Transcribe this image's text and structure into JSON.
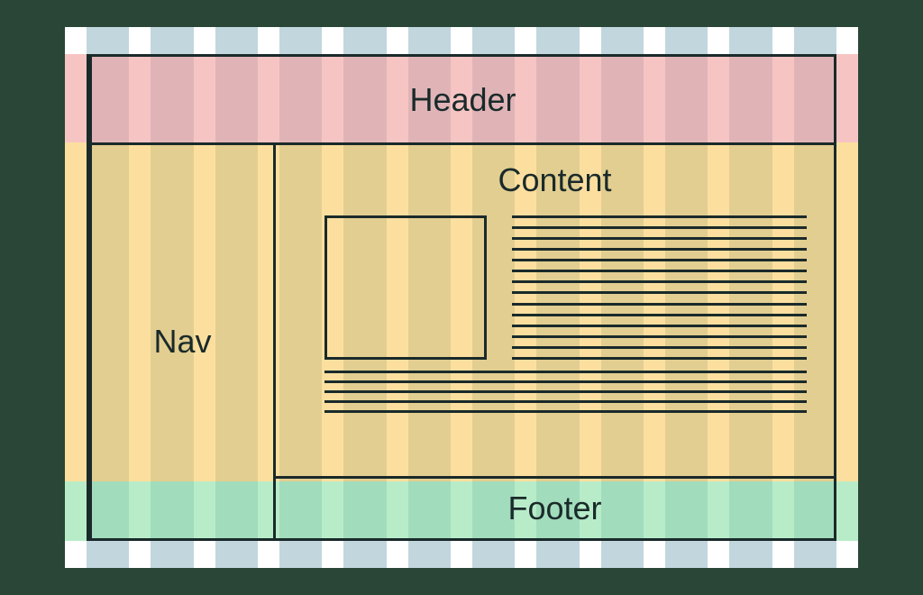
{
  "regions": {
    "header": "Header",
    "nav": "Nav",
    "content": "Content",
    "footer": "Footer"
  },
  "grid": {
    "columns": 12,
    "content_lines_right": 14,
    "content_lines_full": 5
  },
  "colors": {
    "column": "#c2d6dd",
    "header_row": "#f2a0a0",
    "middle_row": "#fac85a",
    "footer_row": "#8ce0a8",
    "border": "#1a2a2a",
    "background": "#294636"
  }
}
